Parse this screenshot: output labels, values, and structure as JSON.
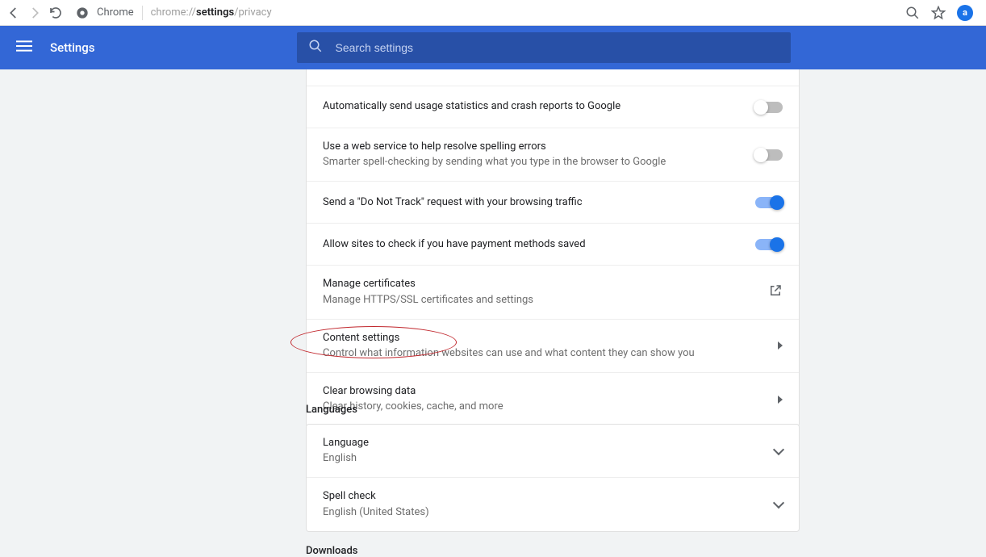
{
  "browser": {
    "title": "Chrome",
    "url_prefix": "chrome://",
    "url_bold": "settings",
    "url_suffix": "/privacy",
    "profile_letter": "a"
  },
  "header": {
    "title": "Settings",
    "search_placeholder": "Search settings"
  },
  "privacy": {
    "row_partial": {
      "title": ""
    },
    "row_usage": {
      "title": "Automatically send usage statistics and crash reports to Google",
      "on": false
    },
    "row_spell": {
      "title": "Use a web service to help resolve spelling errors",
      "sub": "Smarter spell-checking by sending what you type in the browser to Google",
      "on": false
    },
    "row_dnt": {
      "title": "Send a \"Do Not Track\" request with your browsing traffic",
      "on": true
    },
    "row_payment": {
      "title": "Allow sites to check if you have payment methods saved",
      "on": true
    },
    "row_certs": {
      "title": "Manage certificates",
      "sub": "Manage HTTPS/SSL certificates and settings"
    },
    "row_content": {
      "title": "Content settings",
      "sub": "Control what information websites can use and what content they can show you"
    },
    "row_clear": {
      "title": "Clear browsing data",
      "sub": "Clear history, cookies, cache, and more"
    }
  },
  "sections": {
    "languages_label": "Languages",
    "downloads_label": "Downloads"
  },
  "languages": {
    "row_lang": {
      "title": "Language",
      "sub": "English"
    },
    "row_spellcheck": {
      "title": "Spell check",
      "sub": "English (United States)"
    }
  }
}
